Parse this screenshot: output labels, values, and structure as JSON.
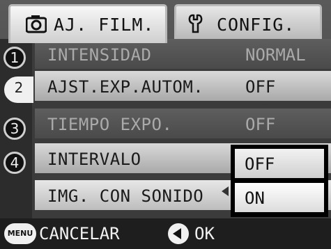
{
  "tabs": [
    {
      "label": "AJ. FILM.",
      "icon": "camera-icon"
    },
    {
      "label": "CONFIG.",
      "icon": "wrench-icon"
    }
  ],
  "pages": [
    "1",
    "2",
    "3",
    "4"
  ],
  "active_page": "2",
  "rows": [
    {
      "label": "INTENSIDAD",
      "value": "NORMAL"
    },
    {
      "label": "AJST.EXP.AUTOM.",
      "value": "OFF"
    },
    {
      "label": "TIEMPO EXPO.",
      "value": "OFF"
    },
    {
      "label": "INTERVALO",
      "value": ""
    },
    {
      "label": "IMG. CON SONIDO",
      "value": ""
    }
  ],
  "dropdown": {
    "options": [
      "OFF",
      "ON"
    ],
    "selected": "ON"
  },
  "footer": {
    "menu_label": "MENU",
    "cancel": "CANCELAR",
    "ok": "OK"
  }
}
